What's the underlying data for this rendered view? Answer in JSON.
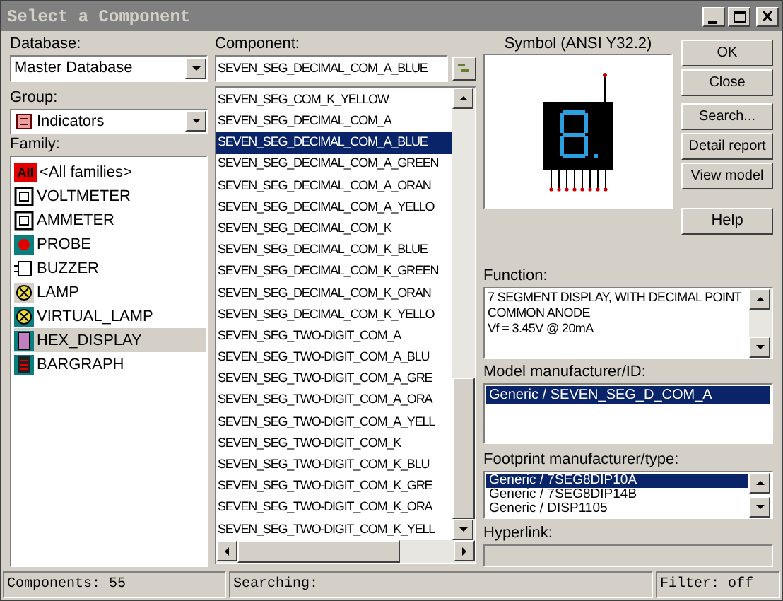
{
  "window": {
    "title": "Select a Component"
  },
  "database": {
    "label": "Database:",
    "value": "Master Database"
  },
  "group": {
    "label": "Group:",
    "value": "Indicators"
  },
  "family": {
    "label": "Family:",
    "items": [
      {
        "name": "<All families>",
        "kind": "all",
        "icon_text": "All",
        "selected": false
      },
      {
        "name": "VOLTMETER",
        "kind": "meter",
        "selected": false
      },
      {
        "name": "AMMETER",
        "kind": "meter",
        "selected": false
      },
      {
        "name": "PROBE",
        "kind": "probe",
        "selected": false
      },
      {
        "name": "BUZZER",
        "kind": "buzzer",
        "selected": false
      },
      {
        "name": "LAMP",
        "kind": "lamp",
        "selected": false
      },
      {
        "name": "VIRTUAL_LAMP",
        "kind": "virtual_lamp",
        "selected": false
      },
      {
        "name": "HEX_DISPLAY",
        "kind": "display",
        "selected": true
      },
      {
        "name": "BARGRAPH",
        "kind": "bargraph",
        "selected": false
      }
    ]
  },
  "component": {
    "label": "Component:",
    "value": "SEVEN_SEG_DECIMAL_COM_A_BLUE",
    "items": [
      {
        "name": "SEVEN_SEG_COM_K_YELLOW",
        "selected": false
      },
      {
        "name": "SEVEN_SEG_DECIMAL_COM_A",
        "selected": false
      },
      {
        "name": "SEVEN_SEG_DECIMAL_COM_A_BLUE",
        "selected": true
      },
      {
        "name": "SEVEN_SEG_DECIMAL_COM_A_GREEN",
        "selected": false
      },
      {
        "name": "SEVEN_SEG_DECIMAL_COM_A_ORAN",
        "selected": false
      },
      {
        "name": "SEVEN_SEG_DECIMAL_COM_A_YELLO",
        "selected": false
      },
      {
        "name": "SEVEN_SEG_DECIMAL_COM_K",
        "selected": false
      },
      {
        "name": "SEVEN_SEG_DECIMAL_COM_K_BLUE",
        "selected": false
      },
      {
        "name": "SEVEN_SEG_DECIMAL_COM_K_GREEN",
        "selected": false
      },
      {
        "name": "SEVEN_SEG_DECIMAL_COM_K_ORAN",
        "selected": false
      },
      {
        "name": "SEVEN_SEG_DECIMAL_COM_K_YELLO",
        "selected": false
      },
      {
        "name": "SEVEN_SEG_TWO-DIGIT_COM_A",
        "selected": false
      },
      {
        "name": "SEVEN_SEG_TWO-DIGIT_COM_A_BLU",
        "selected": false
      },
      {
        "name": "SEVEN_SEG_TWO-DIGIT_COM_A_GRE",
        "selected": false
      },
      {
        "name": "SEVEN_SEG_TWO-DIGIT_COM_A_ORA",
        "selected": false
      },
      {
        "name": "SEVEN_SEG_TWO-DIGIT_COM_A_YELL",
        "selected": false
      },
      {
        "name": "SEVEN_SEG_TWO-DIGIT_COM_K",
        "selected": false
      },
      {
        "name": "SEVEN_SEG_TWO-DIGIT_COM_K_BLU",
        "selected": false
      },
      {
        "name": "SEVEN_SEG_TWO-DIGIT_COM_K_GRE",
        "selected": false
      },
      {
        "name": "SEVEN_SEG_TWO-DIGIT_COM_K_ORA",
        "selected": false
      },
      {
        "name": "SEVEN_SEG_TWO-DIGIT_COM_K_YELL",
        "selected": false
      }
    ]
  },
  "symbol": {
    "label": "Symbol (ANSI Y32.2)"
  },
  "buttons": [
    "OK",
    "Close",
    "Search...",
    "Detail report",
    "View model"
  ],
  "help_button": "Help",
  "function": {
    "label": "Function:",
    "lines": [
      "7 SEGMENT DISPLAY, WITH DECIMAL POINT",
      "COMMON ANODE",
      "Vf = 3.45V @ 20mA"
    ]
  },
  "model": {
    "label": "Model manufacturer/ID:",
    "items": [
      {
        "name": "Generic / SEVEN_SEG_D_COM_A",
        "selected": true
      }
    ]
  },
  "footprint": {
    "label": "Footprint manufacturer/type:",
    "items": [
      {
        "name": "Generic / 7SEG8DIP10A",
        "selected": true
      },
      {
        "name": "Generic / 7SEG8DIP14B",
        "selected": false
      },
      {
        "name": "Generic / DISP1105",
        "selected": false
      }
    ]
  },
  "hyperlink": {
    "label": "Hyperlink:"
  },
  "status_bar": {
    "components": "Components: 55",
    "searching": "Searching:",
    "filter": "Filter: off"
  }
}
